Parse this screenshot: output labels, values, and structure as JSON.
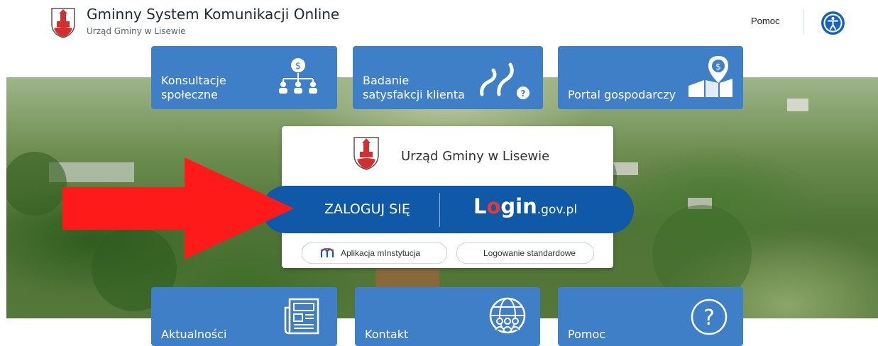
{
  "header": {
    "title": "Gminny System Komunikacji Online",
    "subtitle": "Urząd Gminy w Lisewie",
    "help_link": "Pomoc",
    "accessibility_icon": "accessibility-icon"
  },
  "tiles_top": [
    {
      "label_line1": "Konsultacje",
      "label_line2": "społeczne",
      "icon": "people-dollar-icon"
    },
    {
      "label_line1": "Badanie",
      "label_line2": "satysfakcji klienta",
      "icon": "path-question-icon"
    },
    {
      "label_line1": "Portal gospodarczy",
      "label_line2": "",
      "icon": "map-pin-dollar-icon"
    }
  ],
  "tiles_bottom": [
    {
      "label": "Aktualności",
      "icon": "newspaper-icon"
    },
    {
      "label": "Kontakt",
      "icon": "globe-people-icon"
    },
    {
      "label": "Pomoc",
      "icon": "question-circle-icon"
    }
  ],
  "login_card": {
    "title": "Urząd Gminy w Lisewie",
    "login_button": "ZALOGUJ SIĘ",
    "login_gov_brand_l": "L",
    "login_gov_brand_o": "o",
    "login_gov_brand_gin": "gin",
    "login_gov_brand_suffix": ".gov.pl",
    "option_minstytucja": "Aplikacja mInstytucja",
    "option_standard": "Logowanie standardowe"
  },
  "colors": {
    "tile_blue": "#3f7fc8",
    "login_bar_blue": "#1059a8",
    "arrow_red": "#ff1a1a",
    "brand_red": "#e53935"
  }
}
